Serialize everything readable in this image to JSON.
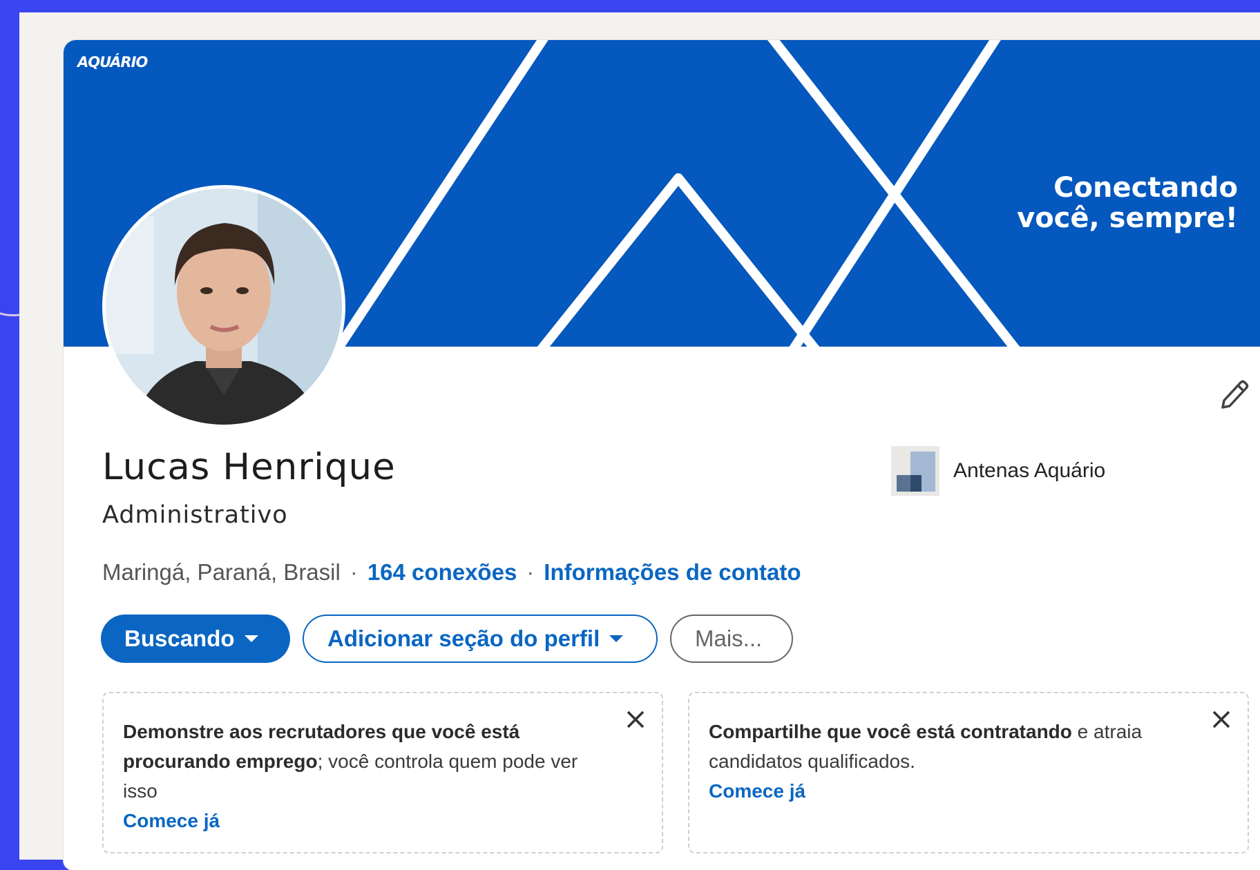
{
  "banner": {
    "logo_text": "AQUÁRIO",
    "slogan_line1": "Conectando",
    "slogan_line2": "você, sempre!",
    "color": "#0558bd"
  },
  "profile": {
    "name": "Lucas Henrique",
    "headline": "Administrativo",
    "location": "Maringá, Paraná, Brasil",
    "connections": "164 conexões",
    "contact_info": "Informações de contato"
  },
  "company": {
    "name": "Antenas Aquário"
  },
  "actions": {
    "primary_label": "Buscando",
    "secondary_label": "Adicionar seção do perfil",
    "more_label": "Mais..."
  },
  "suggestions": [
    {
      "bold_text": "Demonstre aos recrutadores que você está procurando emprego",
      "rest_text": "; você controla quem pode ver isso",
      "cta": "Comece já"
    },
    {
      "bold_text": "Compartilhe que você está contratando",
      "rest_text": " e atraia candidatos qualificados.",
      "cta": "Comece já"
    }
  ],
  "icons": {
    "edit": "pencil-icon",
    "close": "close-icon",
    "caret": "caret-down-icon"
  },
  "colors": {
    "accent": "#0a66c2",
    "background": "#3a44f0"
  }
}
